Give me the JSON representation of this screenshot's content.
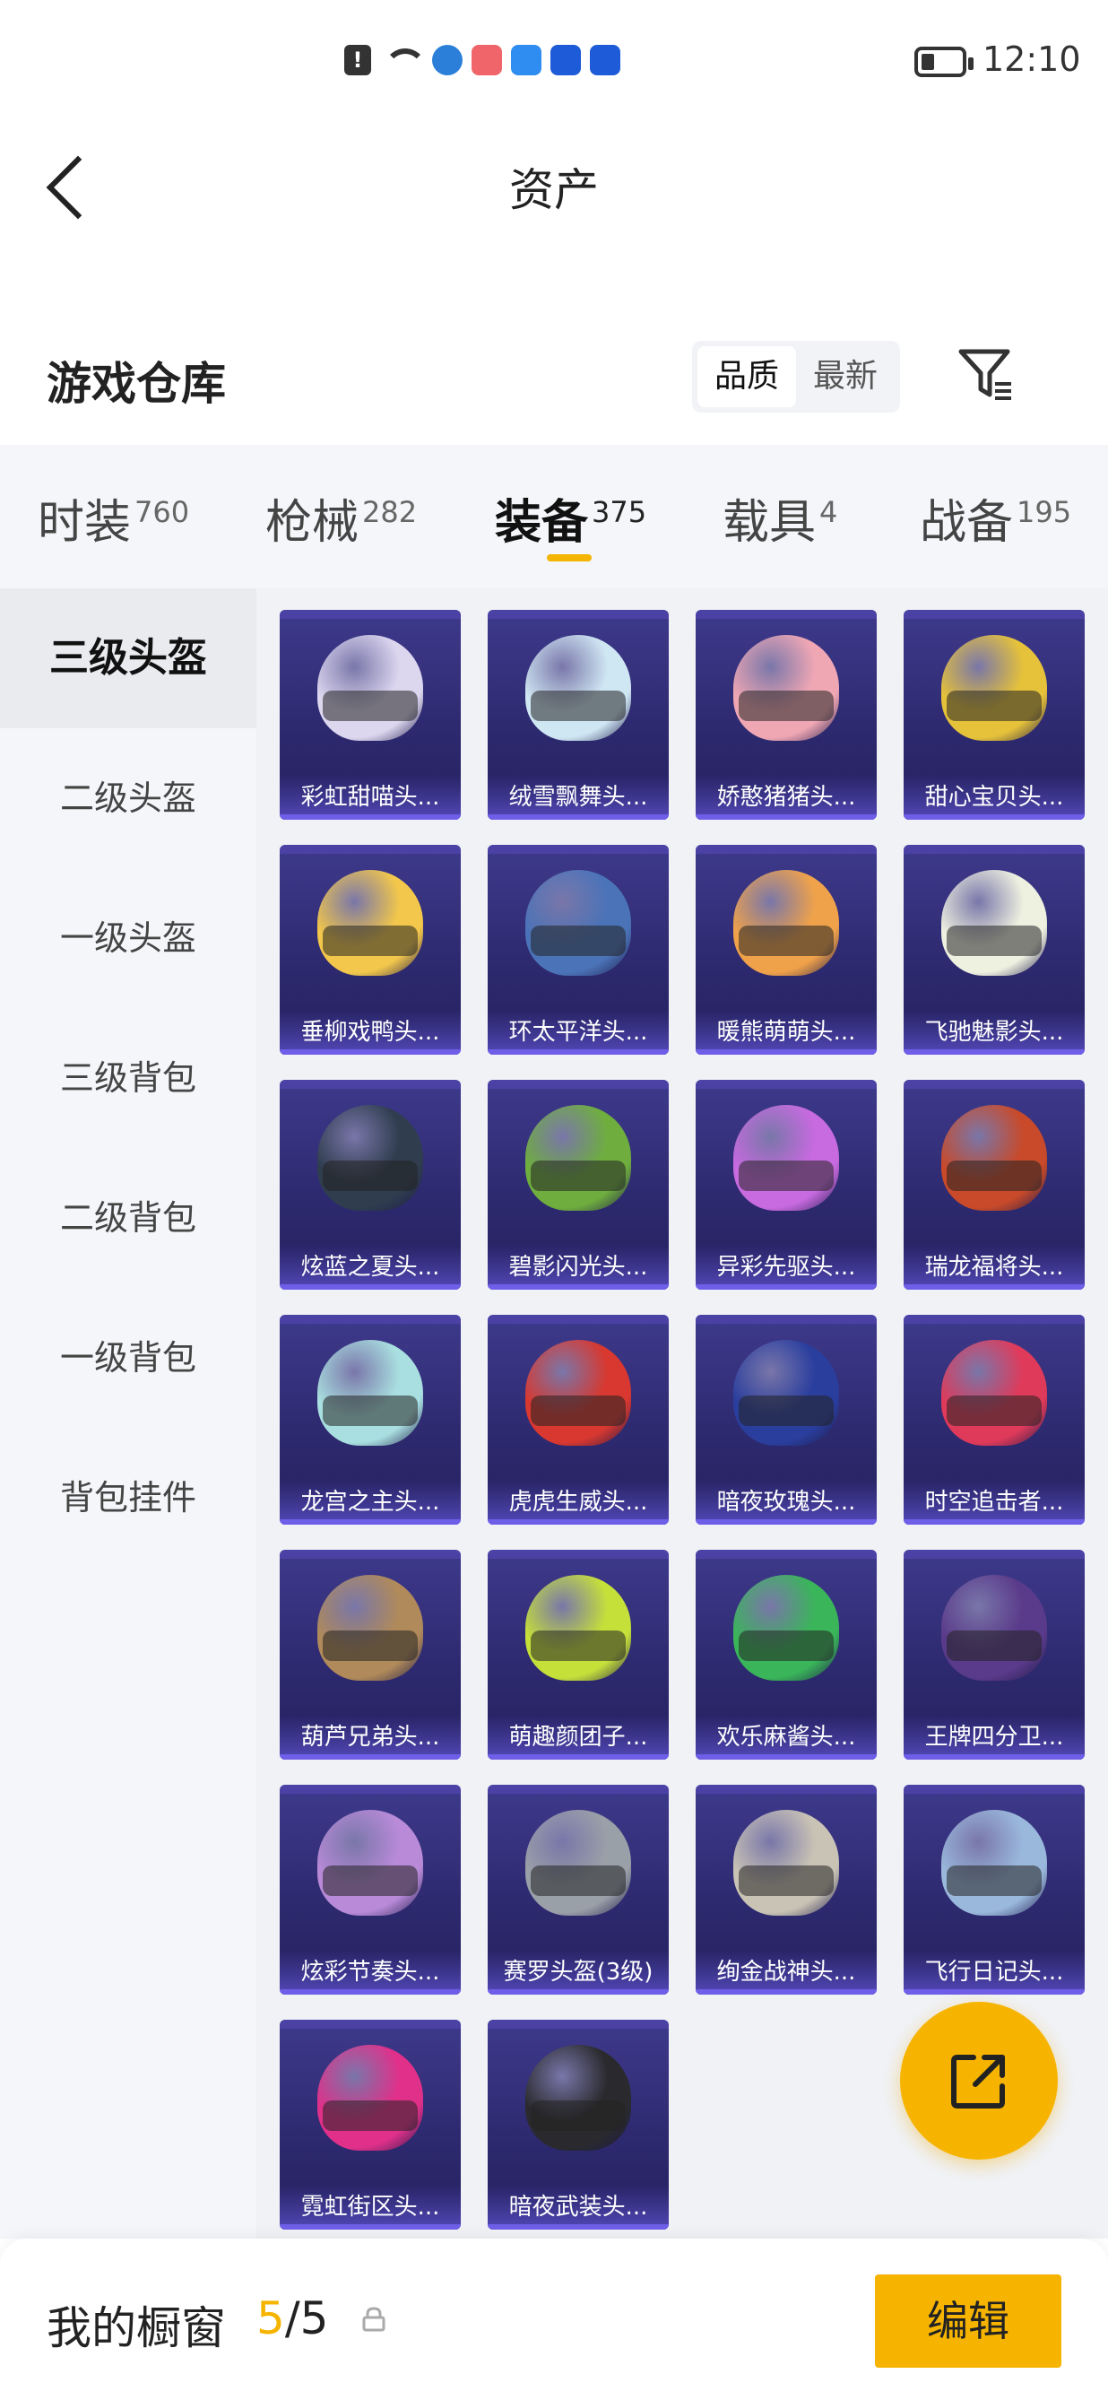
{
  "status_bar": {
    "time": "12:10",
    "icons": [
      "alert-icon",
      "wifi-icon",
      "browser-icon",
      "app-icon",
      "cloud-icon",
      "bulb-icon",
      "bulb-icon"
    ]
  },
  "header": {
    "title": "资产",
    "back_icon": "back-arrow-icon"
  },
  "warehouse": {
    "title": "游戏仓库",
    "sort_options": [
      "品质",
      "最新"
    ],
    "sort_selected": "品质",
    "filter_icon": "filter-icon"
  },
  "categories": [
    {
      "label": "时装",
      "count": "760"
    },
    {
      "label": "枪械",
      "count": "282"
    },
    {
      "label": "装备",
      "count": "375",
      "active": true
    },
    {
      "label": "载具",
      "count": "4"
    },
    {
      "label": "战备",
      "count": "195"
    }
  ],
  "sidebar": {
    "items": [
      "三级头盔",
      "二级头盔",
      "一级头盔",
      "三级背包",
      "二级背包",
      "一级背包",
      "背包挂件"
    ],
    "active": "三级头盔"
  },
  "items": [
    {
      "name": "彩虹甜喵头...",
      "color": "#dcd6ef"
    },
    {
      "name": "绒雪飘舞头...",
      "color": "#cfe6f3"
    },
    {
      "name": "娇憨猪猪头...",
      "color": "#f0a7b4"
    },
    {
      "name": "甜心宝贝头...",
      "color": "#e6c23a"
    },
    {
      "name": "垂柳戏鸭头...",
      "color": "#f2c74b"
    },
    {
      "name": "环太平洋头...",
      "color": "#4b73b8"
    },
    {
      "name": "暖熊萌萌头...",
      "color": "#f0a24a"
    },
    {
      "name": "飞驰魅影头...",
      "color": "#eef0e0"
    },
    {
      "name": "炫蓝之夏头...",
      "color": "#2f3d4f"
    },
    {
      "name": "碧影闪光头...",
      "color": "#6fae3e"
    },
    {
      "name": "异彩先驱头...",
      "color": "#c86ae0"
    },
    {
      "name": "瑞龙福将头...",
      "color": "#c84a2a"
    },
    {
      "name": "龙宫之主头...",
      "color": "#a9dfe0"
    },
    {
      "name": "虎虎生威头...",
      "color": "#d8382f"
    },
    {
      "name": "暗夜玫瑰头...",
      "color": "#2a3e9e"
    },
    {
      "name": "时空追击者...",
      "color": "#e03a5a"
    },
    {
      "name": "葫芦兄弟头...",
      "color": "#b08a5a"
    },
    {
      "name": "萌趣颜团子...",
      "color": "#c6e03a"
    },
    {
      "name": "欢乐麻酱头...",
      "color": "#3ab55a"
    },
    {
      "name": "王牌四分卫...",
      "color": "#5a3a8a"
    },
    {
      "name": "炫彩节奏头...",
      "color": "#b88ad8"
    },
    {
      "name": "赛罗头盔(3级)",
      "color": "#9aa0a8"
    },
    {
      "name": "绚金战神头...",
      "color": "#c9c3b5"
    },
    {
      "name": "飞行日记头...",
      "color": "#9ab8dc"
    },
    {
      "name": "霓虹街区头...",
      "color": "#e0308a"
    },
    {
      "name": "暗夜武装头...",
      "color": "#2a2a2e"
    }
  ],
  "share_button_icon": "share-icon",
  "bottom_bar": {
    "label": "我的橱窗",
    "current": "5",
    "separator": "/",
    "total": "5",
    "lock_icon": "lock-icon",
    "edit_label": "编辑"
  },
  "colors": {
    "accent": "#f6b400",
    "card_bg": "#2e2a70",
    "sidebar_bg": "#f4f6f9"
  }
}
